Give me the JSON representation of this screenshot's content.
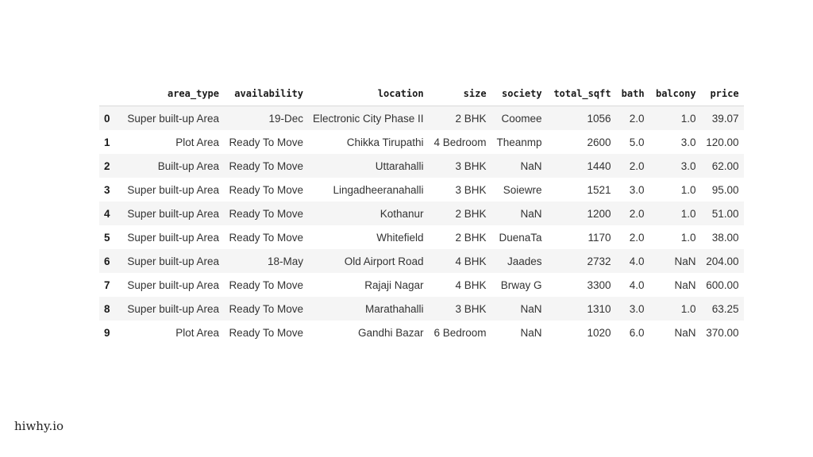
{
  "table": {
    "index_header": "",
    "columns": [
      "area_type",
      "availability",
      "location",
      "size",
      "society",
      "total_sqft",
      "bath",
      "balcony",
      "price"
    ],
    "rows": [
      {
        "index": "0",
        "cells": [
          "Super built-up Area",
          "19-Dec",
          "Electronic City Phase II",
          "2 BHK",
          "Coomee",
          "1056",
          "2.0",
          "1.0",
          "39.07"
        ]
      },
      {
        "index": "1",
        "cells": [
          "Plot Area",
          "Ready To Move",
          "Chikka Tirupathi",
          "4 Bedroom",
          "Theanmp",
          "2600",
          "5.0",
          "3.0",
          "120.00"
        ]
      },
      {
        "index": "2",
        "cells": [
          "Built-up Area",
          "Ready To Move",
          "Uttarahalli",
          "3 BHK",
          "NaN",
          "1440",
          "2.0",
          "3.0",
          "62.00"
        ]
      },
      {
        "index": "3",
        "cells": [
          "Super built-up Area",
          "Ready To Move",
          "Lingadheeranahalli",
          "3 BHK",
          "Soiewre",
          "1521",
          "3.0",
          "1.0",
          "95.00"
        ]
      },
      {
        "index": "4",
        "cells": [
          "Super built-up Area",
          "Ready To Move",
          "Kothanur",
          "2 BHK",
          "NaN",
          "1200",
          "2.0",
          "1.0",
          "51.00"
        ]
      },
      {
        "index": "5",
        "cells": [
          "Super built-up Area",
          "Ready To Move",
          "Whitefield",
          "2 BHK",
          "DuenaTa",
          "1170",
          "2.0",
          "1.0",
          "38.00"
        ]
      },
      {
        "index": "6",
        "cells": [
          "Super built-up Area",
          "18-May",
          "Old Airport Road",
          "4 BHK",
          "Jaades",
          "2732",
          "4.0",
          "NaN",
          "204.00"
        ]
      },
      {
        "index": "7",
        "cells": [
          "Super built-up Area",
          "Ready To Move",
          "Rajaji Nagar",
          "4 BHK",
          "Brway G",
          "3300",
          "4.0",
          "NaN",
          "600.00"
        ]
      },
      {
        "index": "8",
        "cells": [
          "Super built-up Area",
          "Ready To Move",
          "Marathahalli",
          "3 BHK",
          "NaN",
          "1310",
          "3.0",
          "1.0",
          "63.25"
        ]
      },
      {
        "index": "9",
        "cells": [
          "Plot Area",
          "Ready To Move",
          "Gandhi Bazar",
          "6 Bedroom",
          "NaN",
          "1020",
          "6.0",
          "NaN",
          "370.00"
        ]
      }
    ]
  },
  "watermark": {
    "text": "hiwhy.io"
  },
  "colors": {
    "stripe": "#f5f5f5",
    "text": "#333333",
    "header_text": "#1a1a1a"
  }
}
